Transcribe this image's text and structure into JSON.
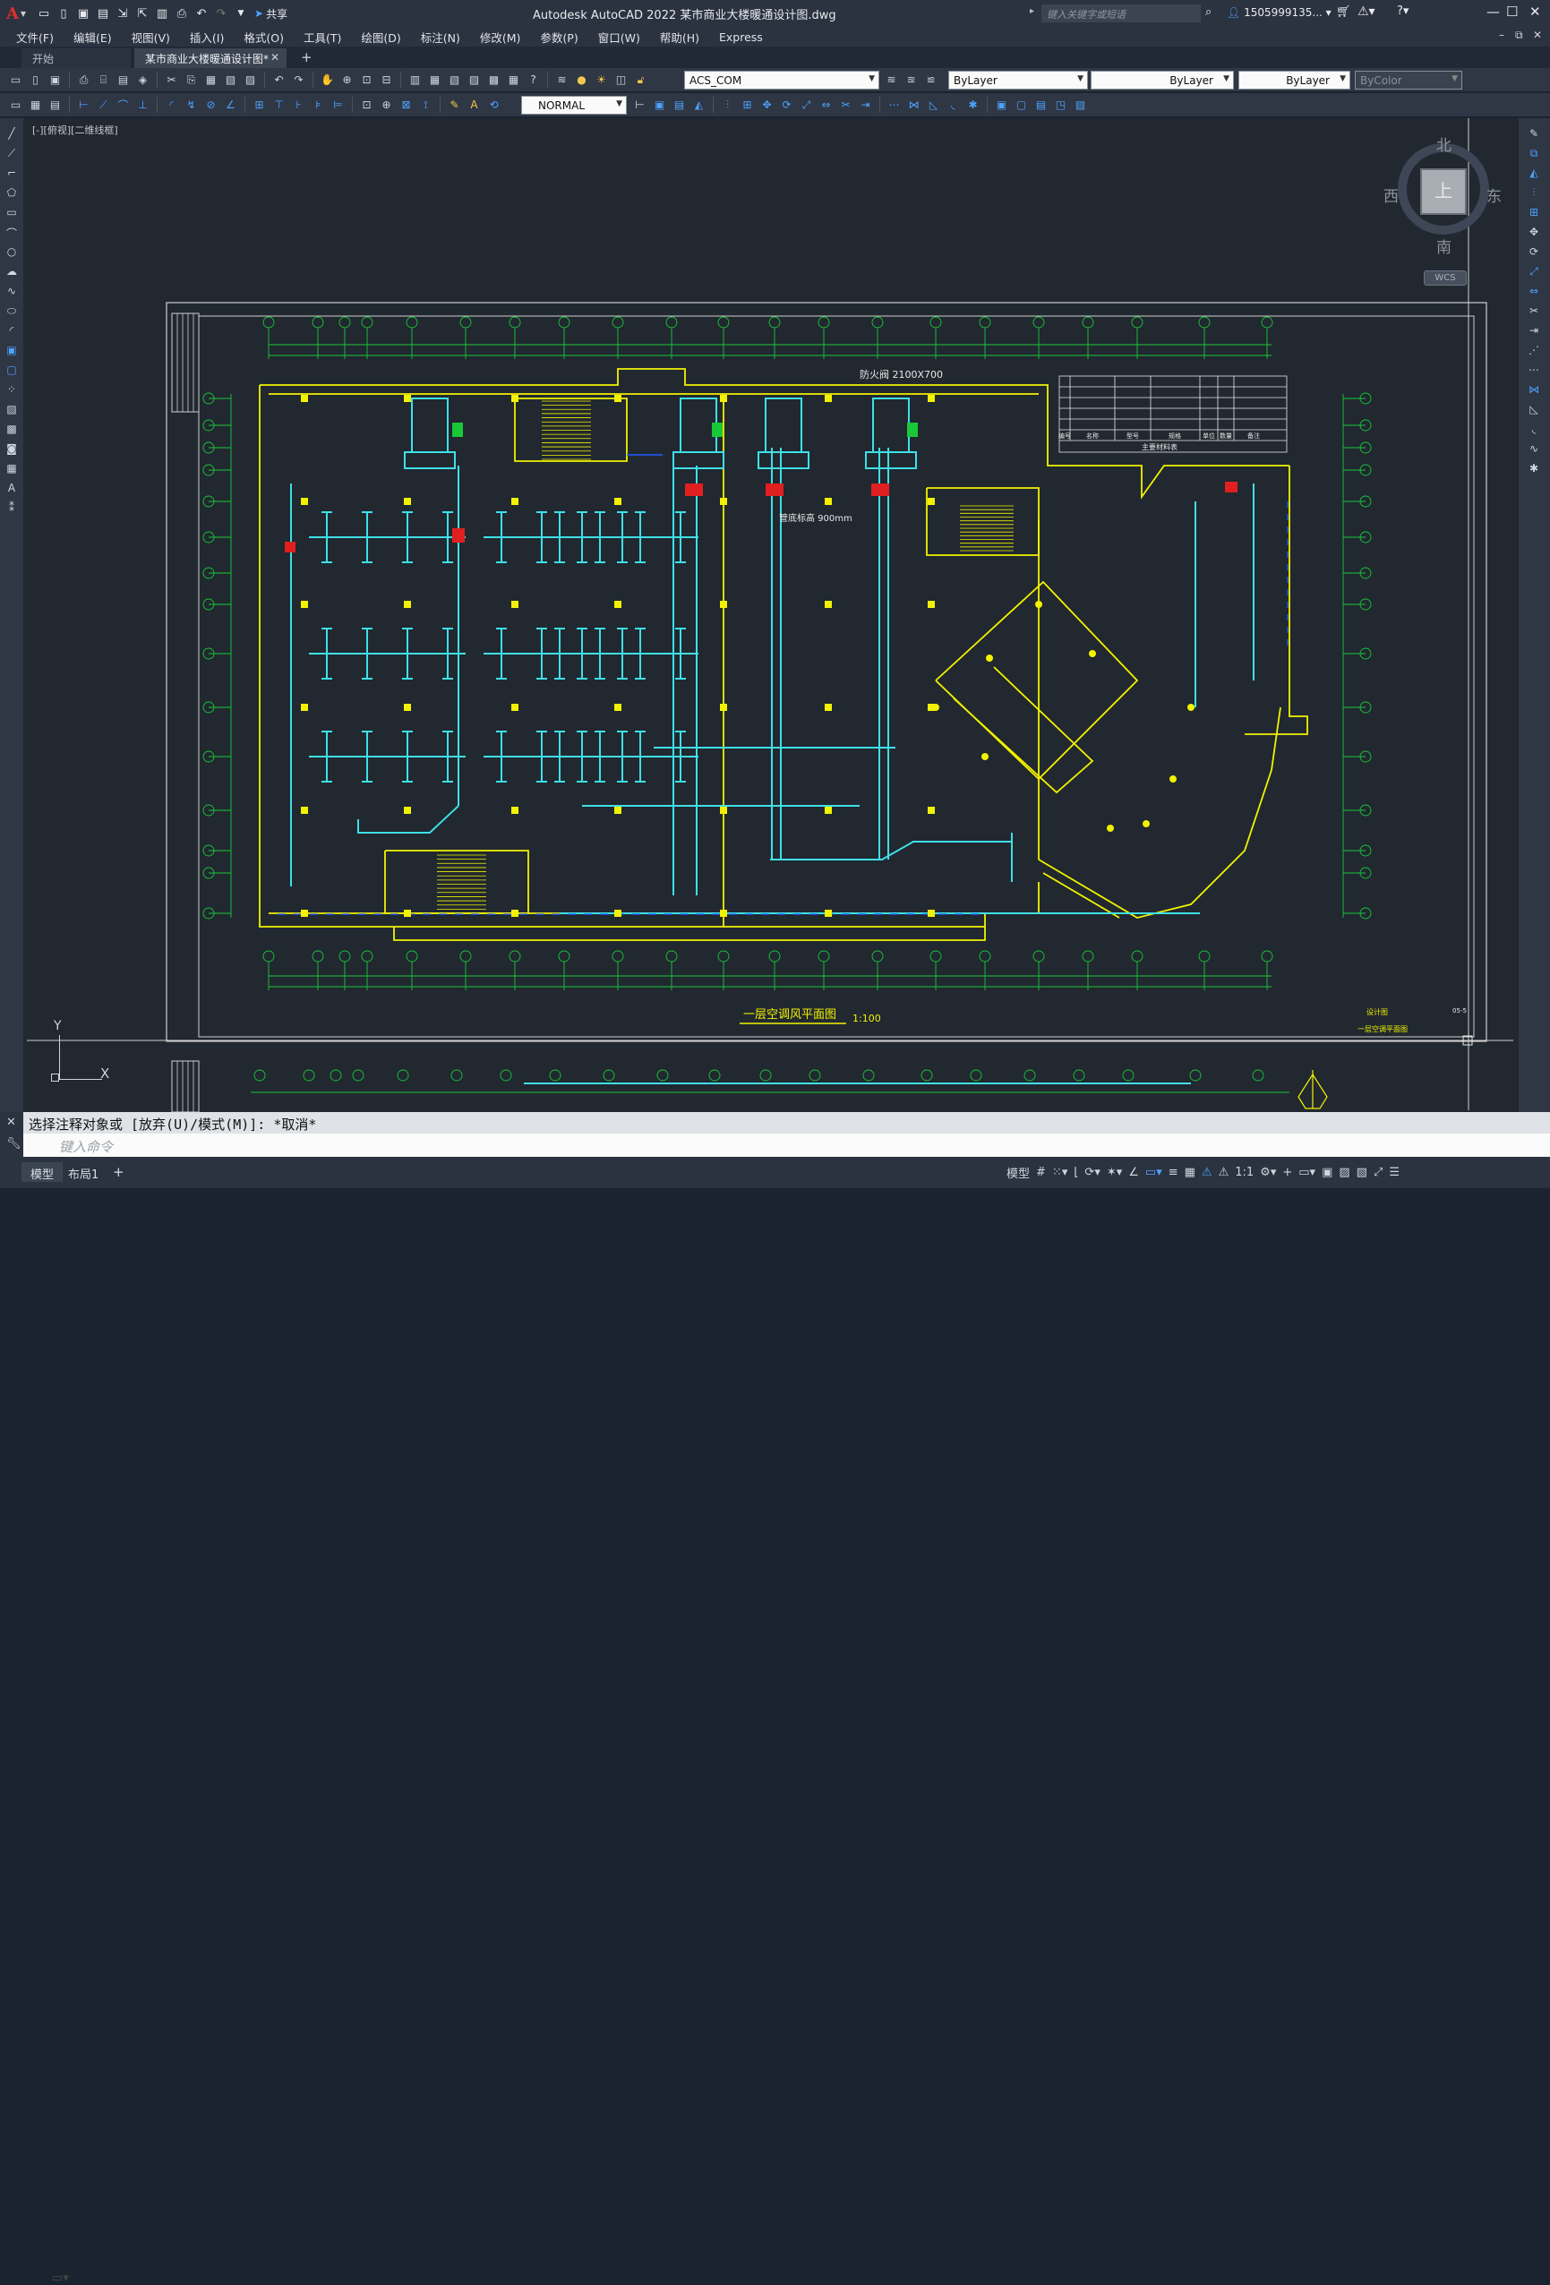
{
  "app": {
    "title": "Autodesk AutoCAD 2022    某市商业大楼暖通设计图.dwg",
    "logo_letter": "A",
    "share_label": "共享",
    "search_placeholder": "键入关键字或短语",
    "user_name": "1505999135..."
  },
  "menu": [
    "文件(F)",
    "编辑(E)",
    "视图(V)",
    "插入(I)",
    "格式(O)",
    "工具(T)",
    "绘图(D)",
    "标注(N)",
    "修改(M)",
    "参数(P)",
    "窗口(W)",
    "帮助(H)",
    "Express"
  ],
  "tabs": {
    "start": "开始",
    "active": "某市商业大楼暖通设计图*"
  },
  "toolbar": {
    "layer_value": "ACS_COM",
    "color_value": "ByLayer",
    "linetype_value": "ByLayer",
    "lineweight_value": "ByLayer",
    "plotstyle_value": "ByColor",
    "dimstyle_value": "NORMAL"
  },
  "viewport": {
    "view_label": "[-][俯视][二维线框]",
    "viewcube": {
      "north": "北",
      "south": "南",
      "east": "东",
      "west": "西",
      "face": "上",
      "wcs": "WCS"
    },
    "ucs": {
      "y": "Y",
      "x": "X"
    }
  },
  "drawing": {
    "main_title": "一层空调风平面图",
    "scale": "1:100",
    "duct_note": "防火阀 2100X700",
    "duct_height_note": "管底标高 900mm",
    "legend_title": "主要材料表",
    "legend_headers": [
      "编号",
      "名称",
      "型号",
      "规格",
      "单位",
      "数量",
      "备注"
    ],
    "right_block_labels": [
      "设计图",
      "一层空调平面图"
    ],
    "sheet_no": "05-5"
  },
  "command": {
    "history": "选择注释对象或 [放弃(U)/模式(M)]: *取消*",
    "prompt_placeholder": "键入命令"
  },
  "status": {
    "model_tab": "模型",
    "layout_tab": "布局1",
    "mode_label": "模型",
    "scale_label": "1:1"
  },
  "colors": {
    "background": "#212830",
    "duct_cyan": "#3fe0e6",
    "wall_yellow": "#f2f200",
    "grid_green": "#19c837",
    "annotation_blue": "#1e5cff",
    "equipment_red": "#e02020"
  }
}
